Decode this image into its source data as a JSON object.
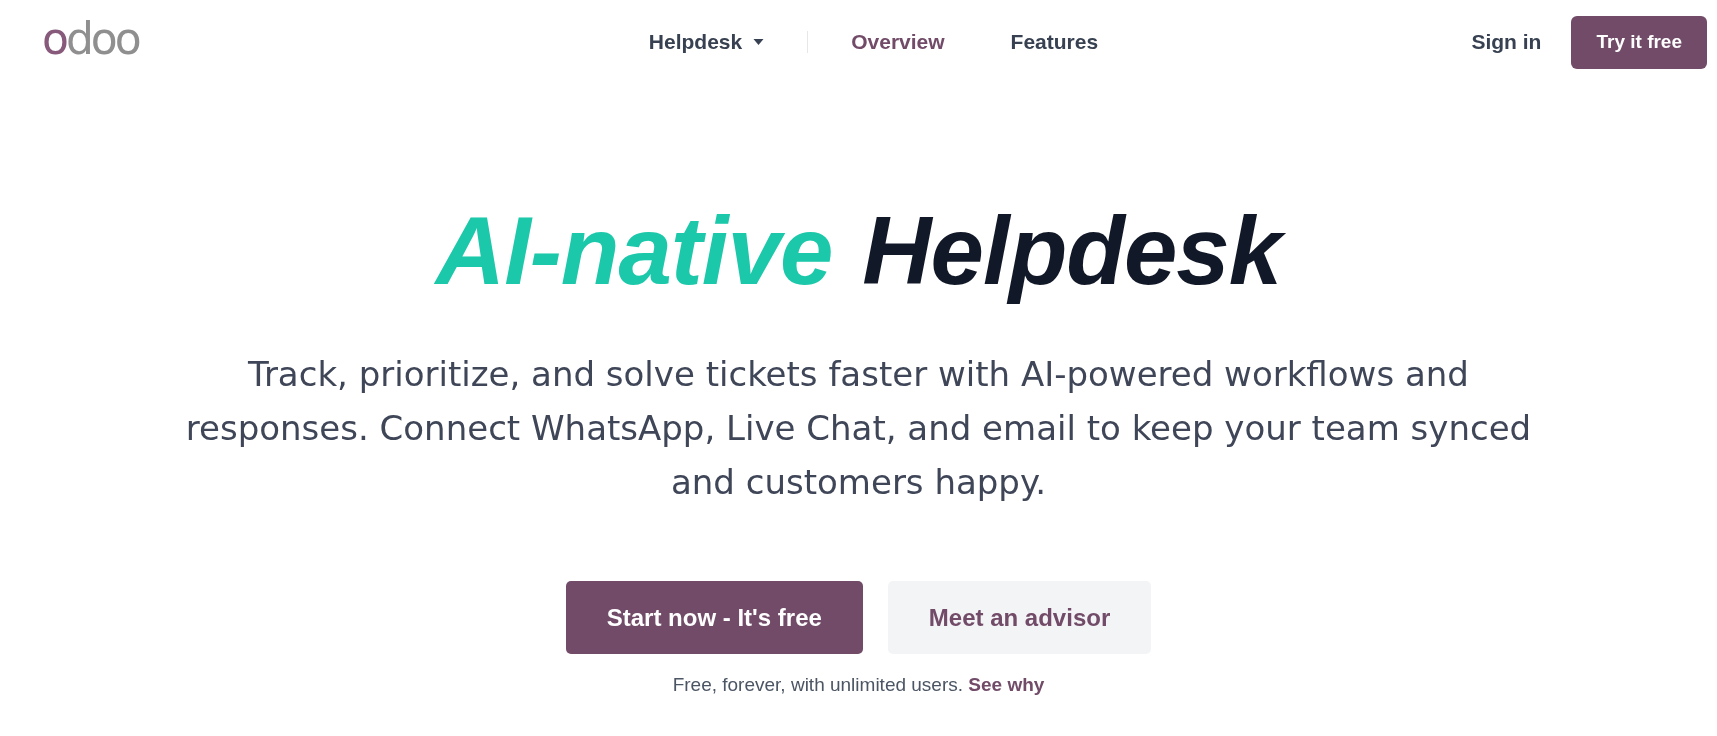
{
  "logo": {
    "text": "odoo"
  },
  "nav": {
    "items": [
      {
        "label": "Helpdesk",
        "kind": "dropdown",
        "selected": false
      },
      {
        "label": "Overview",
        "kind": "link",
        "selected": true
      },
      {
        "label": "Features",
        "kind": "link",
        "selected": false
      }
    ]
  },
  "header_actions": {
    "sign_in": "Sign in",
    "try_button": "Try it free"
  },
  "hero": {
    "title": [
      {
        "text": "AI-native",
        "kind": "accent"
      },
      {
        "text": "Helpdesk",
        "kind": "plain"
      }
    ],
    "description": "Track, prioritize, and solve tickets faster with AI-powered workflows and responses. Connect WhatsApp, Live Chat, and email to keep your team synced and customers happy.",
    "buttons": [
      {
        "label": "Start now - It's free",
        "kind": "primary"
      },
      {
        "label": "Meet an advisor",
        "kind": "secondary"
      }
    ],
    "note": {
      "text": "Free, forever, with unlimited users.",
      "link": "See why"
    }
  }
}
